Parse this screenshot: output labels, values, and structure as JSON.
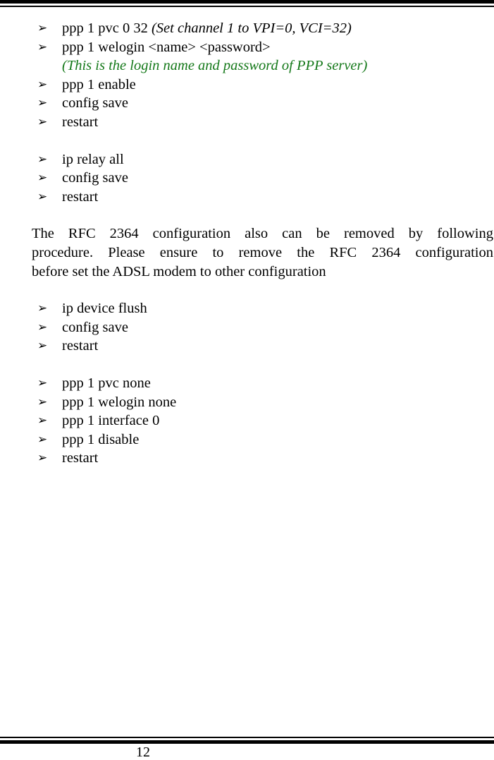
{
  "page": {
    "number": "12",
    "bullet_glyph": "➢"
  },
  "sections": [
    {
      "id": "pppoa-setup",
      "items": [
        {
          "text": "ppp 1 pvc 0 32",
          "note": "(Set channel 1 to VPI=0, VCI=32)",
          "note_style": "italic"
        },
        {
          "text": "ppp 1 welogin <name> <password>",
          "note": "",
          "note_style": "none"
        },
        {
          "text": "ppp 1 enable",
          "note": "",
          "note_style": "none"
        },
        {
          "text": "config save",
          "note": "",
          "note_style": "none"
        },
        {
          "text": "restart",
          "note": "",
          "note_style": "none"
        }
      ],
      "green_note": "(This is the login name and password of PPP server)",
      "green_note_after_index": 1
    },
    {
      "id": "ip-relay",
      "items": [
        {
          "text": "ip relay all",
          "note": "",
          "note_style": "none"
        },
        {
          "text": "config save",
          "note": "",
          "note_style": "none"
        },
        {
          "text": "restart",
          "note": "",
          "note_style": "none"
        }
      ]
    },
    {
      "id": "ip-device-flush",
      "items": [
        {
          "text": "ip device flush",
          "note": "",
          "note_style": "none"
        },
        {
          "text": "config save",
          "note": "",
          "note_style": "none"
        },
        {
          "text": "restart",
          "note": "",
          "note_style": "none"
        }
      ]
    },
    {
      "id": "ppp-teardown",
      "items": [
        {
          "text": "ppp 1 pvc none",
          "note": "",
          "note_style": "none"
        },
        {
          "text": "ppp 1 welogin none",
          "note": "",
          "note_style": "none"
        },
        {
          "text": "ppp 1 interface 0",
          "note": "",
          "note_style": "none"
        },
        {
          "text": "ppp 1 disable",
          "note": "",
          "note_style": "none"
        },
        {
          "text": "restart",
          "note": "",
          "note_style": "none"
        }
      ]
    }
  ],
  "paragraph": {
    "lines": [
      "The RFC 2364 configuration also can be removed by following",
      "procedure. Please ensure to remove the RFC 2364 configuration",
      "before set the ADSL modem to other configuration"
    ],
    "full_text": "The RFC 2364 configuration also can be removed by following procedure. Please ensure to remove the RFC 2364 configuration before set the ADSL modem to other configuration"
  },
  "colors": {
    "text": "#000000",
    "note_green": "#15791a",
    "rule": "#000000",
    "background": "#ffffff"
  }
}
